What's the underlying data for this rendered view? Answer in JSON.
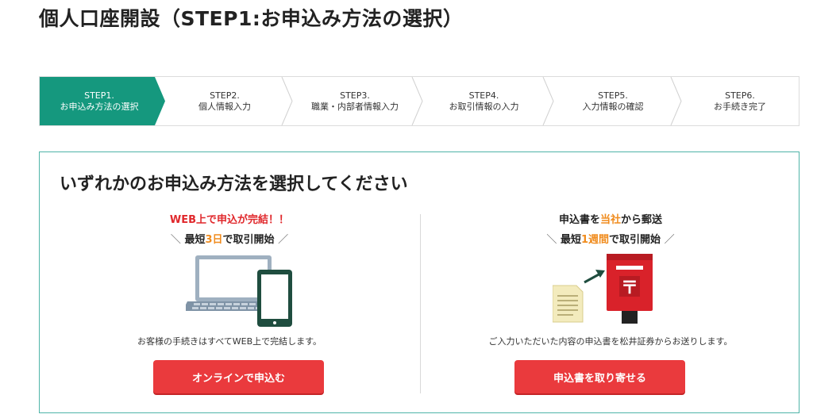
{
  "page": {
    "title": "個人口座開設（STEP1:お申込み方法の選択）"
  },
  "stepper": {
    "steps": [
      {
        "num": "STEP1.",
        "label": "お申込み方法の選択",
        "active": true
      },
      {
        "num": "STEP2.",
        "label": "個人情報入力",
        "active": false
      },
      {
        "num": "STEP3.",
        "label": "職業・内部者情報入力",
        "active": false
      },
      {
        "num": "STEP4.",
        "label": "お取引情報の入力",
        "active": false
      },
      {
        "num": "STEP5.",
        "label": "入力情報の確認",
        "active": false
      },
      {
        "num": "STEP6.",
        "label": "お手続き完了",
        "active": false
      }
    ],
    "active_color": "#15987e"
  },
  "panel": {
    "heading": "いずれかのお申込み方法を選択してください",
    "online": {
      "headline": "WEB上で申込が完結！！",
      "slash_left": "＼",
      "sub_pre": "最短",
      "sub_highlight": "3日",
      "sub_post": "で取引開始",
      "slash_right": "／",
      "description": "お客様の手続きはすべてWEB上で完結します。",
      "button_label": "オンラインで申込む"
    },
    "mail": {
      "head_pre": "申込書を",
      "head_highlight": "当社",
      "head_post": "から郵送",
      "slash_left": "＼",
      "sub_pre": "最短",
      "sub_highlight": "1週間",
      "sub_post": "で取引開始",
      "slash_right": "／",
      "description": "ご入力いただいた内容の申込書を松井証券からお送りします。",
      "button_label": "申込書を取り寄せる"
    }
  },
  "colors": {
    "accent": "#15987e",
    "cta": "#ea3a3d",
    "highlight": "#f08c1e",
    "headline_red": "#e0282c"
  }
}
